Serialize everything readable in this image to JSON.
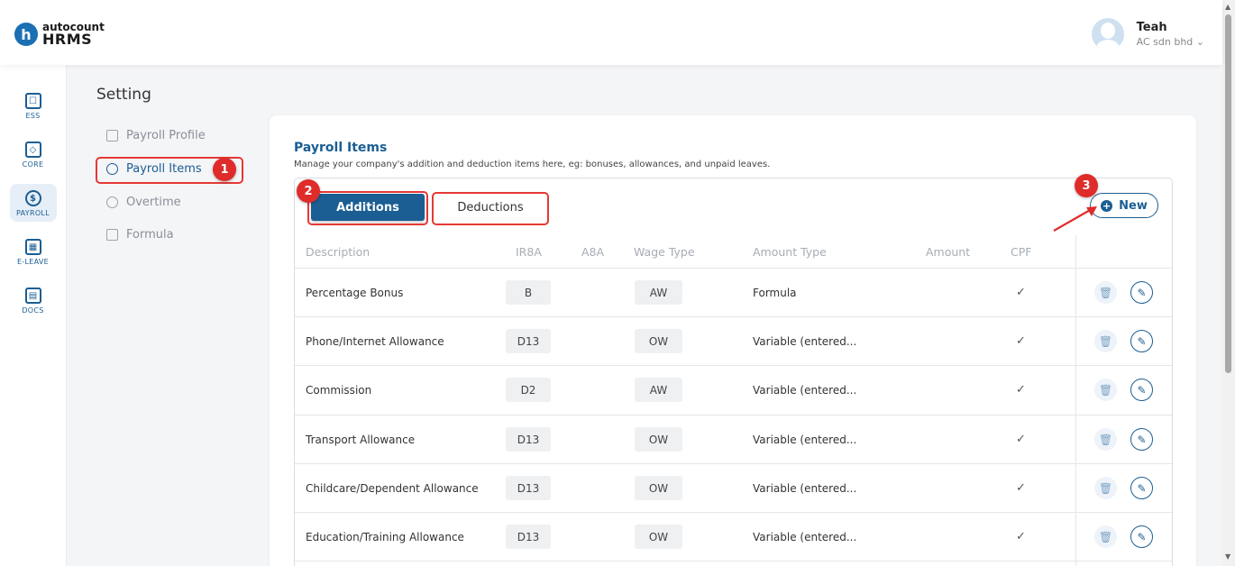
{
  "header": {
    "logo_small": "autocount",
    "logo_big": "HRMS",
    "logo_letter": "h",
    "user_name": "Teah",
    "company": "AC sdn bhd",
    "company_chevron": "⌄"
  },
  "rail": {
    "items": [
      {
        "label": "ESS",
        "icon": "ess-icon",
        "active": false
      },
      {
        "label": "CORE",
        "icon": "core-icon",
        "active": false
      },
      {
        "label": "PAYROLL",
        "icon": "payroll-icon",
        "active": true
      },
      {
        "label": "E-LEAVE",
        "icon": "calendar-icon",
        "active": false
      },
      {
        "label": "DOCS",
        "icon": "docs-icon",
        "active": false
      }
    ]
  },
  "settings": {
    "title": "Setting",
    "menu": [
      {
        "label": "Payroll Profile",
        "icon": "calendar-icon",
        "active": false
      },
      {
        "label": "Payroll Items",
        "icon": "money-icon",
        "active": true
      },
      {
        "label": "Overtime",
        "icon": "clock-icon",
        "active": false
      },
      {
        "label": "Formula",
        "icon": "formula-icon",
        "active": false
      }
    ]
  },
  "card": {
    "title": "Payroll Items",
    "subtitle": "Manage your company's addition and deduction items here, eg: bonuses, allowances, and unpaid leaves."
  },
  "tabs": {
    "additions": "Additions",
    "deductions": "Deductions"
  },
  "new_button": "New",
  "annotations": [
    "1",
    "2",
    "3"
  ],
  "table": {
    "columns": [
      "Description",
      "IR8A",
      "A8A",
      "Wage Type",
      "Amount Type",
      "Amount",
      "CPF"
    ],
    "rows": [
      {
        "description": "Percentage Bonus",
        "ir8a": "B",
        "a8a": "",
        "wage_type": "AW",
        "amount_type": "Formula",
        "amount": "",
        "cpf": "✓"
      },
      {
        "description": "Phone/Internet Allowance",
        "ir8a": "D13",
        "a8a": "",
        "wage_type": "OW",
        "amount_type": "Variable (entered...",
        "amount": "",
        "cpf": "✓"
      },
      {
        "description": "Commission",
        "ir8a": "D2",
        "a8a": "",
        "wage_type": "AW",
        "amount_type": "Variable (entered...",
        "amount": "",
        "cpf": "✓"
      },
      {
        "description": "Transport Allowance",
        "ir8a": "D13",
        "a8a": "",
        "wage_type": "OW",
        "amount_type": "Variable (entered...",
        "amount": "",
        "cpf": "✓"
      },
      {
        "description": "Childcare/Dependent Allowance",
        "ir8a": "D13",
        "a8a": "",
        "wage_type": "OW",
        "amount_type": "Variable (entered...",
        "amount": "",
        "cpf": "✓"
      },
      {
        "description": "Education/Training Allowance",
        "ir8a": "D13",
        "a8a": "",
        "wage_type": "OW",
        "amount_type": "Variable (entered...",
        "amount": "",
        "cpf": "✓"
      }
    ]
  },
  "colors": {
    "primary": "#1b5e93",
    "annotation_red": "#e02b2b"
  }
}
